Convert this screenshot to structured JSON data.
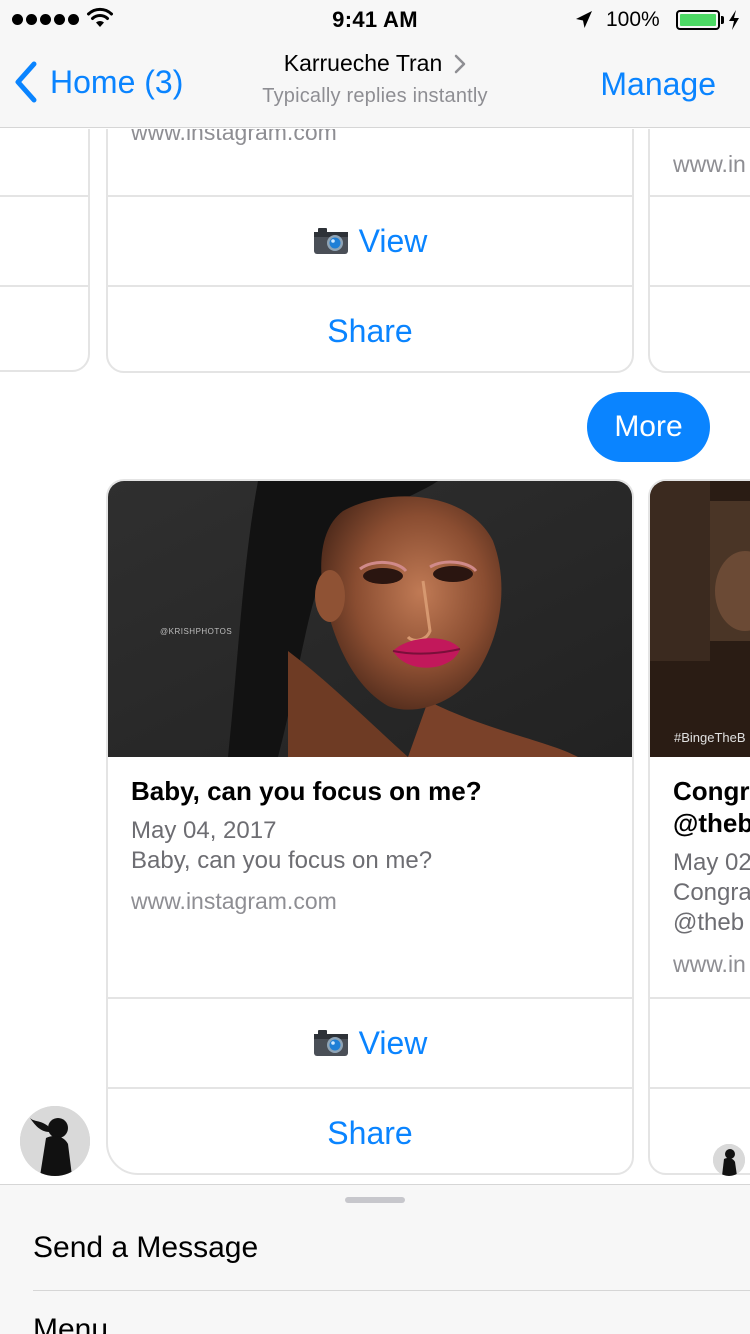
{
  "status_bar": {
    "time": "9:41 AM",
    "battery_percent": "100%",
    "signal_bars": 5,
    "battery_level": 1.0,
    "battery_color": "#4cd964"
  },
  "nav": {
    "back_label": "Home (3)",
    "title": "Karrueche Tran",
    "subtitle": "Typically replies instantly",
    "manage_label": "Manage",
    "accent_color": "#0a84ff"
  },
  "top_carousel": {
    "main_card": {
      "link": "www.instagram.com",
      "view_label": "View",
      "view_icon": "camera-icon",
      "share_label": "Share"
    },
    "right_card": {
      "link": "www.in"
    }
  },
  "more_button": {
    "label": "More"
  },
  "bottom_carousel": {
    "main_card": {
      "photo_watermark": "@KRISHPHOTOS",
      "title": "Baby, can you focus on me?",
      "date": "May 04, 2017",
      "caption": "Baby, can you focus on me?",
      "link": "www.instagram.com",
      "view_label": "View",
      "view_icon": "camera-icon",
      "share_label": "Share"
    },
    "right_card": {
      "photo_watermark": "#BingeTheB",
      "title_line1": "Congr",
      "title_line2": "@theb",
      "date": "May 02",
      "caption_line1": "Congra",
      "caption_line2": "@theb",
      "link": "www.in"
    }
  },
  "sheet": {
    "items": [
      "Send a Message",
      "Menu"
    ]
  }
}
